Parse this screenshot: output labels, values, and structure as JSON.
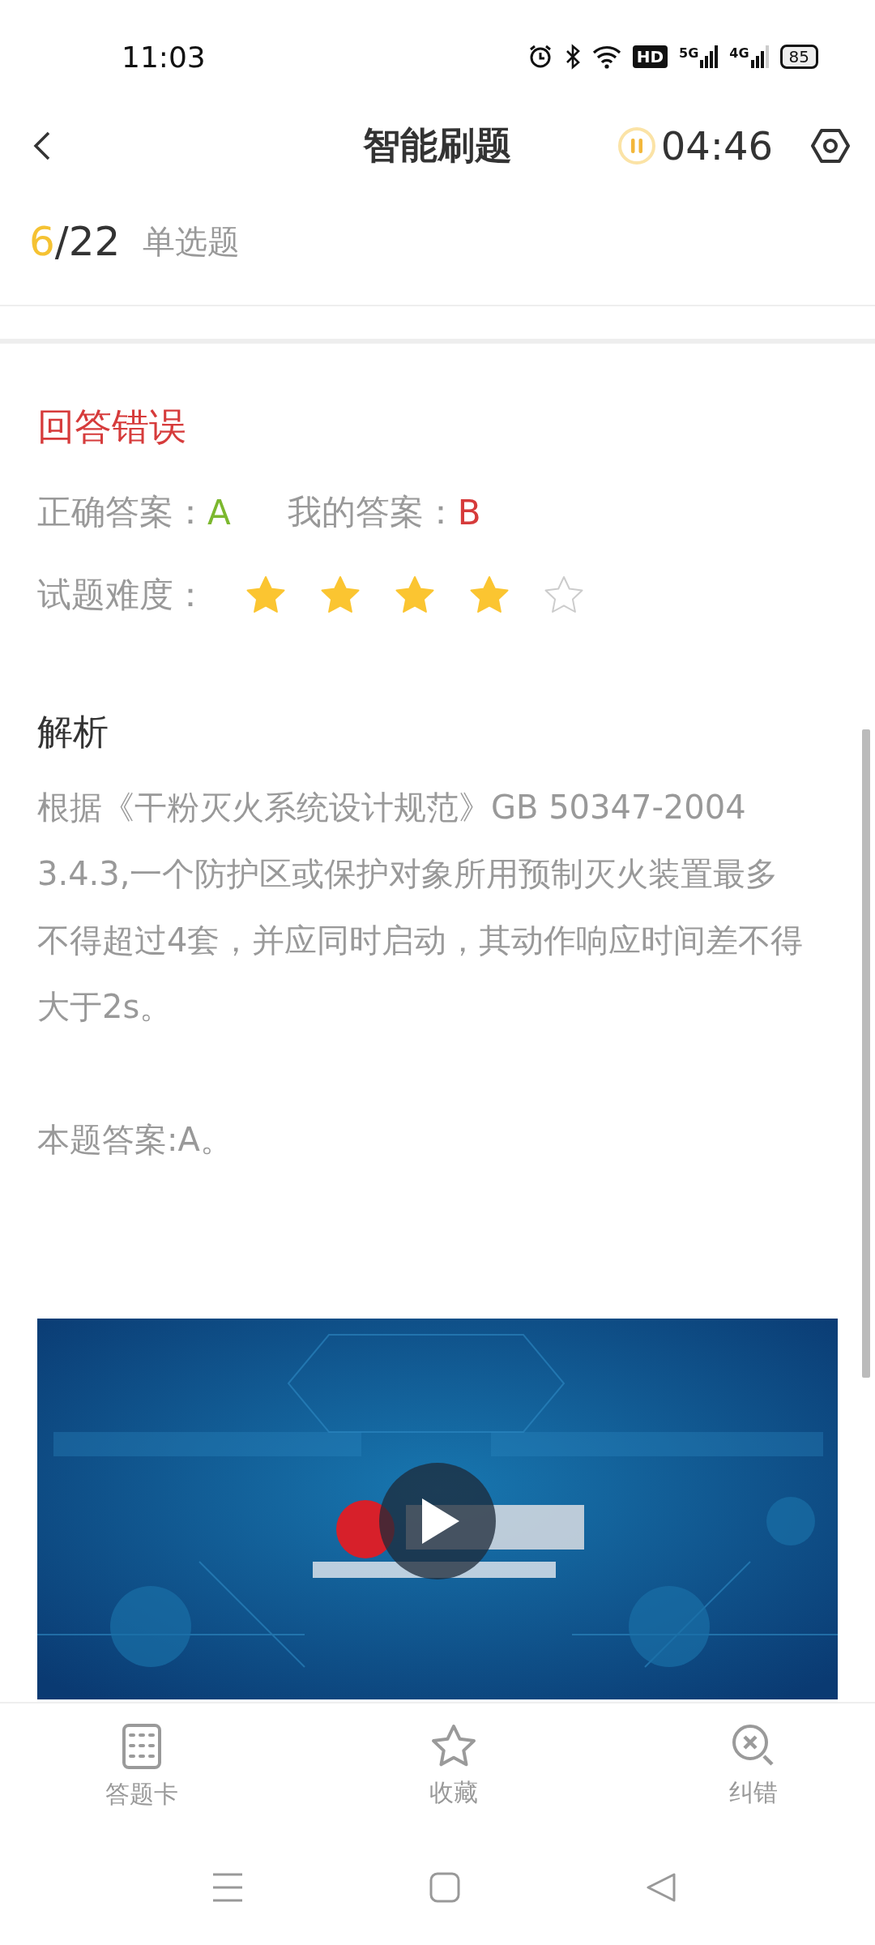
{
  "status_bar": {
    "time": "11:03",
    "hd_badge": "HD",
    "signal_1": "5G",
    "signal_2": "4G",
    "battery": "85"
  },
  "header": {
    "title": "智能刷题",
    "timer": "04:46"
  },
  "progress": {
    "current": "6",
    "total": "/22",
    "type": "单选题"
  },
  "result": {
    "text": "回答错误",
    "correct": false,
    "correct_answer": {
      "label": "正确答案：",
      "value": "A"
    },
    "my_answer": {
      "label": "我的答案：",
      "value": "B"
    },
    "difficulty": {
      "label": "试题难度：",
      "stars": 4
    }
  },
  "analysis": {
    "title": "解析",
    "paragraphs": [
      "根据《干粉灭火系统设计规范》GB 50347-2004 3.4.3,一个防护区或保护对象所用预制灭火装置最多不得超过4套，并应同时启动，其动作响应时间差不得大于2s。",
      "本题答案:A。"
    ]
  },
  "bottom_nav": [
    {
      "label": "答题卡",
      "kind": "card"
    },
    {
      "label": "收藏",
      "kind": "favorite"
    },
    {
      "label": "纠错",
      "kind": "report"
    }
  ]
}
